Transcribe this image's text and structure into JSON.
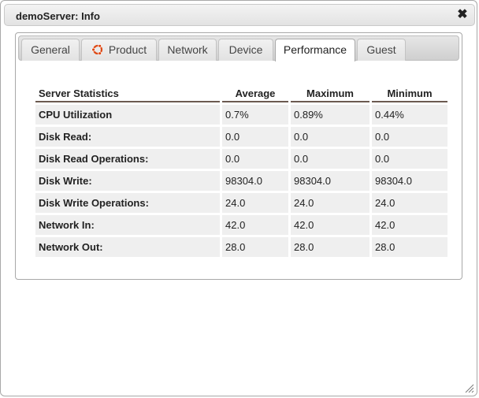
{
  "window": {
    "title": "demoServer: Info",
    "close_icon": "close-icon"
  },
  "tabs": [
    {
      "label": "General",
      "active": false
    },
    {
      "label": "Product",
      "active": false,
      "icon": "ubuntu-logo-icon"
    },
    {
      "label": "Network",
      "active": false
    },
    {
      "label": "Device",
      "active": false
    },
    {
      "label": "Performance",
      "active": true
    },
    {
      "label": "Guest",
      "active": false
    }
  ],
  "table": {
    "headers": [
      "Server Statistics",
      "Average",
      "Maximum",
      "Minimum"
    ],
    "rows": [
      {
        "label": "CPU Utilization",
        "average": "0.7%",
        "maximum": "0.89%",
        "minimum": "0.44%"
      },
      {
        "label": "Disk Read:",
        "average": "0.0",
        "maximum": "0.0",
        "minimum": "0.0"
      },
      {
        "label": "Disk Read Operations:",
        "average": "0.0",
        "maximum": "0.0",
        "minimum": "0.0"
      },
      {
        "label": "Disk Write:",
        "average": "98304.0",
        "maximum": "98304.0",
        "minimum": "98304.0"
      },
      {
        "label": "Disk Write Operations:",
        "average": "24.0",
        "maximum": "24.0",
        "minimum": "24.0"
      },
      {
        "label": "Network In:",
        "average": "42.0",
        "maximum": "42.0",
        "minimum": "42.0"
      },
      {
        "label": "Network Out:",
        "average": "28.0",
        "maximum": "28.0",
        "minimum": "28.0"
      }
    ]
  },
  "colors": {
    "header_underline": "#6b5a50",
    "cell_bg": "#efefef",
    "ubuntu_orange": "#dd4814"
  }
}
